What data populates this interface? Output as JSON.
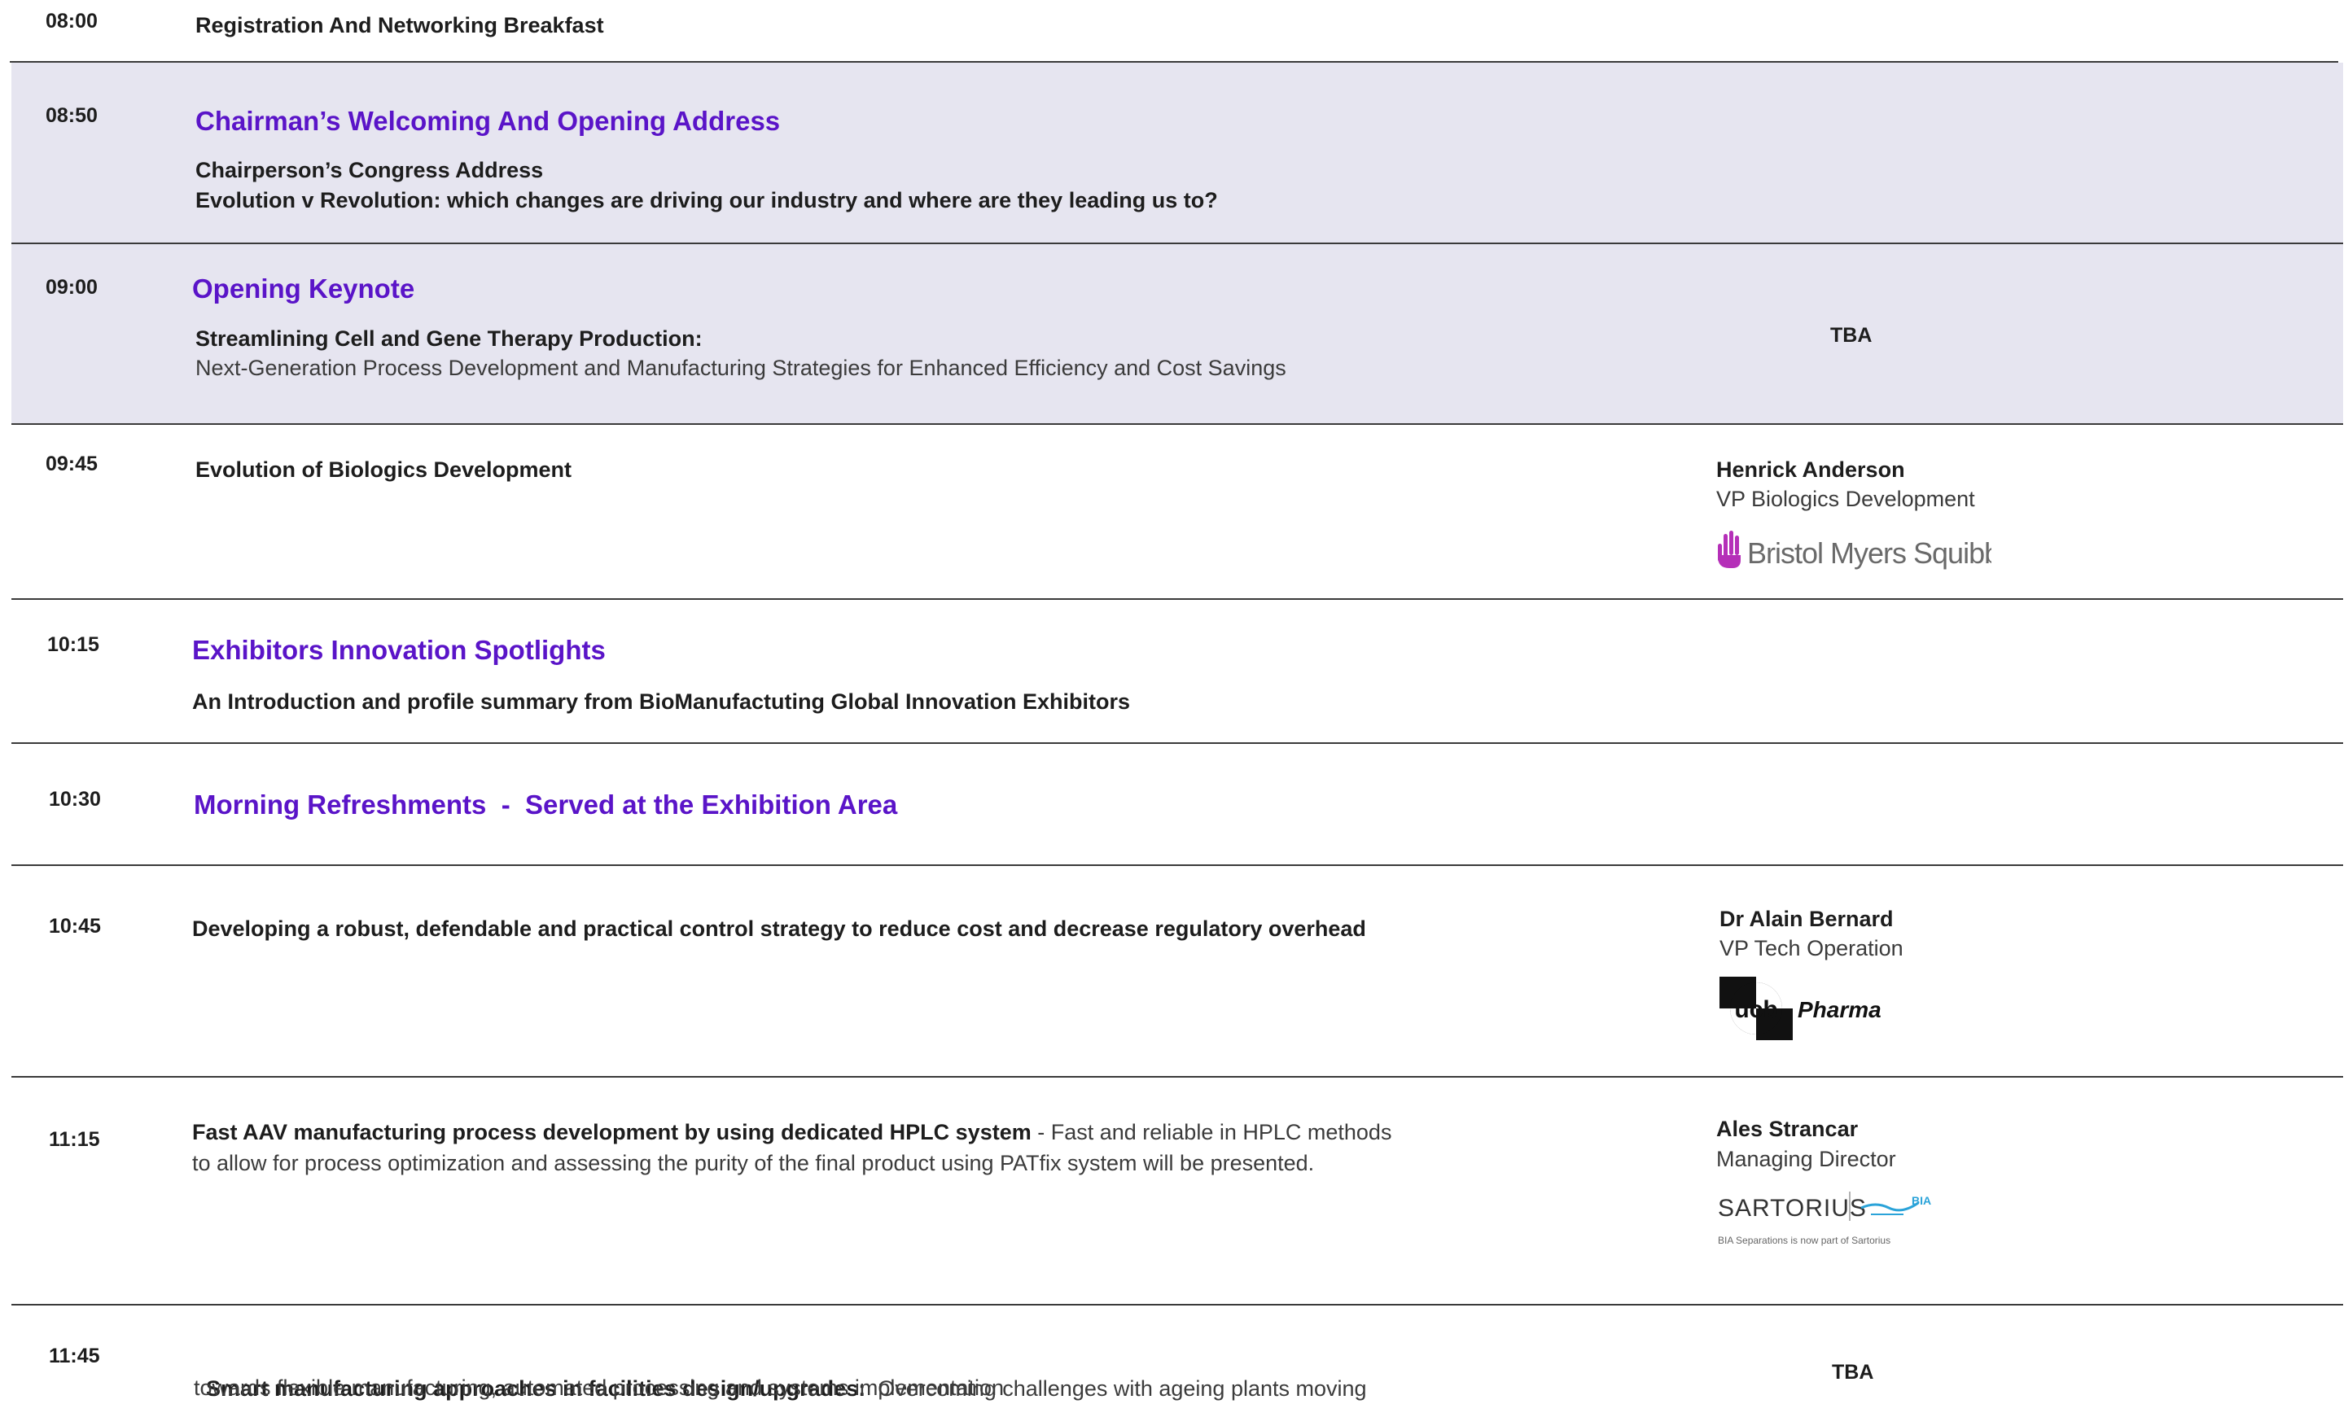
{
  "sessions": [
    {
      "time": "08:00",
      "title": "Registration And Networking Breakfast"
    },
    {
      "time": "08:50",
      "heading": "Chairman’s Welcoming And Opening Address",
      "line1": "Chairperson’s Congress Address",
      "line2": "Evolution v Revolution: which changes are driving our industry and where are they leading us to?"
    },
    {
      "time": "09:00",
      "heading": "Opening Keynote",
      "line1": "Streamlining Cell and Gene Therapy Production:",
      "line2": "Next-Generation Process Development and Manufacturing Strategies for Enhanced Efficiency and Cost Savings",
      "speaker": "TBA"
    },
    {
      "time": "09:45",
      "title": "Evolution of Biologics Development",
      "speaker_name": "Henrick Anderson",
      "speaker_title": "VP Biologics Development",
      "company_logo": "Bristol Myers Squibb"
    },
    {
      "time": "10:15",
      "heading": "Exhibitors Innovation Spotlights",
      "line1": "An Introduction and profile summary from BioManufactuting Global Innovation Exhibitors"
    },
    {
      "time": "10:30",
      "heading": "Morning Refreshments  -  Served at the Exhibition Area"
    },
    {
      "time": "10:45",
      "title": "Developing a robust, defendable and practical control strategy to reduce cost and decrease regulatory overhead",
      "speaker_name": "Dr Alain Bernard",
      "speaker_title": "VP Tech Operation",
      "logo_mark": "ucb",
      "logo_word": "Pharma"
    },
    {
      "time": "11:15",
      "title_bold": "Fast AAV manufacturing process development by using dedicated HPLC system",
      "title_rest": " - Fast and reliable in HPLC methods",
      "line2": "to allow for process optimization and assessing the purity of the final product using PATfix system will be presented.",
      "speaker_name": "Ales Strancar",
      "speaker_title": "Managing Director",
      "logo_main": "SARTORIUS",
      "logo_secondary": "BIA",
      "logo_caption": "BIA Separations is now part of Sartorius"
    },
    {
      "time": "11:45",
      "title_bold": "Smart manufacturing approaches in facilities design/upgrades:",
      "title_rest": "  Overcoming challenges with ageing plants moving",
      "line2": "towards flexible manufacturing, automated processing and systems implementation",
      "speaker": "TBA"
    }
  ],
  "colors": {
    "accent": "#5a14c8",
    "shade": "#e6e5f0",
    "logo_purple": "#b52fb8"
  },
  "icons": {
    "bms": "bms-hand-icon",
    "bia": "bia-wave-icon"
  }
}
